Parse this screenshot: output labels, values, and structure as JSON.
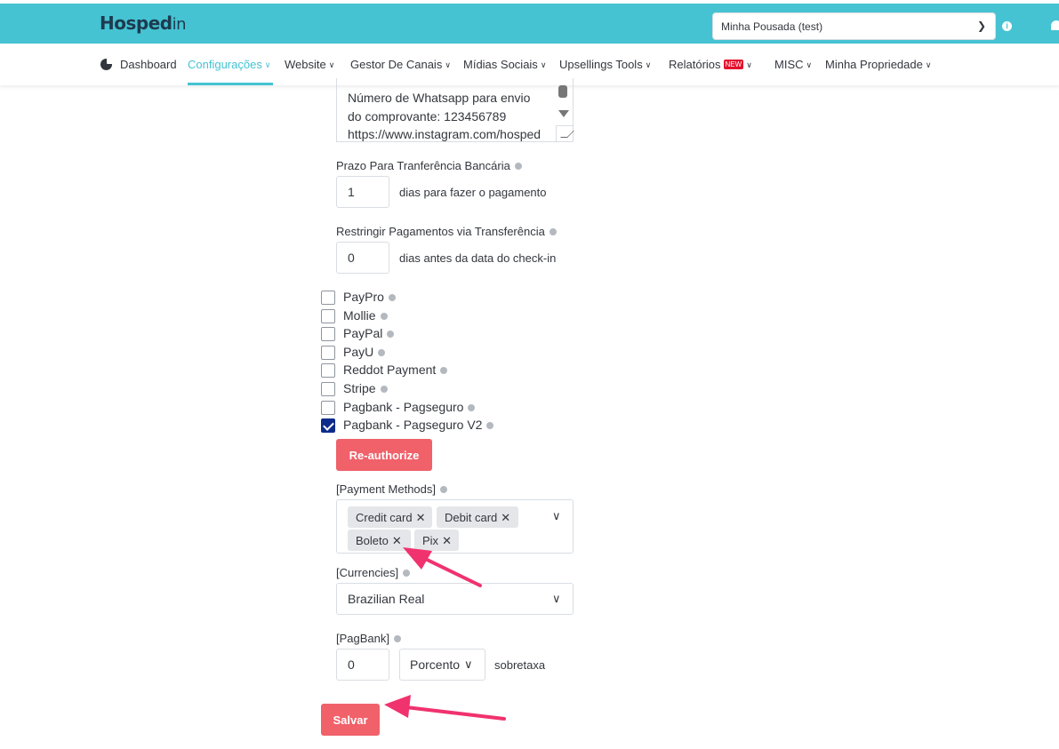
{
  "header": {
    "logo_text_bold": "Hosped",
    "logo_text_light": "in",
    "property_selected": "Minha Pousada (test)",
    "brand_color": "#45c3d2"
  },
  "nav": {
    "items": [
      {
        "label": "Dashboard",
        "icon": "pie-chart-icon"
      },
      {
        "label": "Configurações",
        "active": true
      },
      {
        "label": "Website"
      },
      {
        "label": "Gestor De Canais"
      },
      {
        "label": "Mídias Sociais"
      },
      {
        "label": "Upsellings Tools"
      },
      {
        "label": "Relatórios",
        "badge": "NEW"
      },
      {
        "label": "MISC"
      },
      {
        "label": "Minha Propriedade"
      }
    ]
  },
  "form": {
    "instructions_lines": [
      "Número de Whatsapp para envio",
      "do comprovante: 123456789",
      "https://www.instagram.com/hosped"
    ],
    "transfer_deadline": {
      "label": "Prazo Para Tranferência Bancária",
      "value": "1",
      "hint": "dias para fazer o pagamento"
    },
    "restrict_transfer": {
      "label": "Restringir Pagamentos via Transferência",
      "value": "0",
      "hint": "dias antes da data do check-in"
    },
    "providers": [
      {
        "label": "PayPro",
        "checked": false
      },
      {
        "label": "Mollie",
        "checked": false
      },
      {
        "label": "PayPal",
        "checked": false
      },
      {
        "label": "PayU",
        "checked": false
      },
      {
        "label": "Reddot Payment",
        "checked": false
      },
      {
        "label": "Stripe",
        "checked": false
      },
      {
        "label": "Pagbank - Pagseguro",
        "checked": false
      },
      {
        "label": "Pagbank - Pagseguro V2",
        "checked": true
      }
    ],
    "reauthorize_label": "Re-authorize",
    "payment_methods": {
      "label": "[Payment Methods]",
      "tags": [
        "Credit card",
        "Debit card",
        "Boleto",
        "Pix"
      ]
    },
    "currencies": {
      "label": "[Currencies]",
      "selected": "Brazilian Real"
    },
    "pagbank": {
      "label": "[PagBank]",
      "value": "0",
      "unit_selected": "Porcento",
      "hint": "sobretaxa"
    },
    "save_label": "Salvar",
    "button_color": "#f0616a",
    "checkbox_color": "#0d2b8a",
    "annotation_arrow_color": "#f0326e"
  }
}
